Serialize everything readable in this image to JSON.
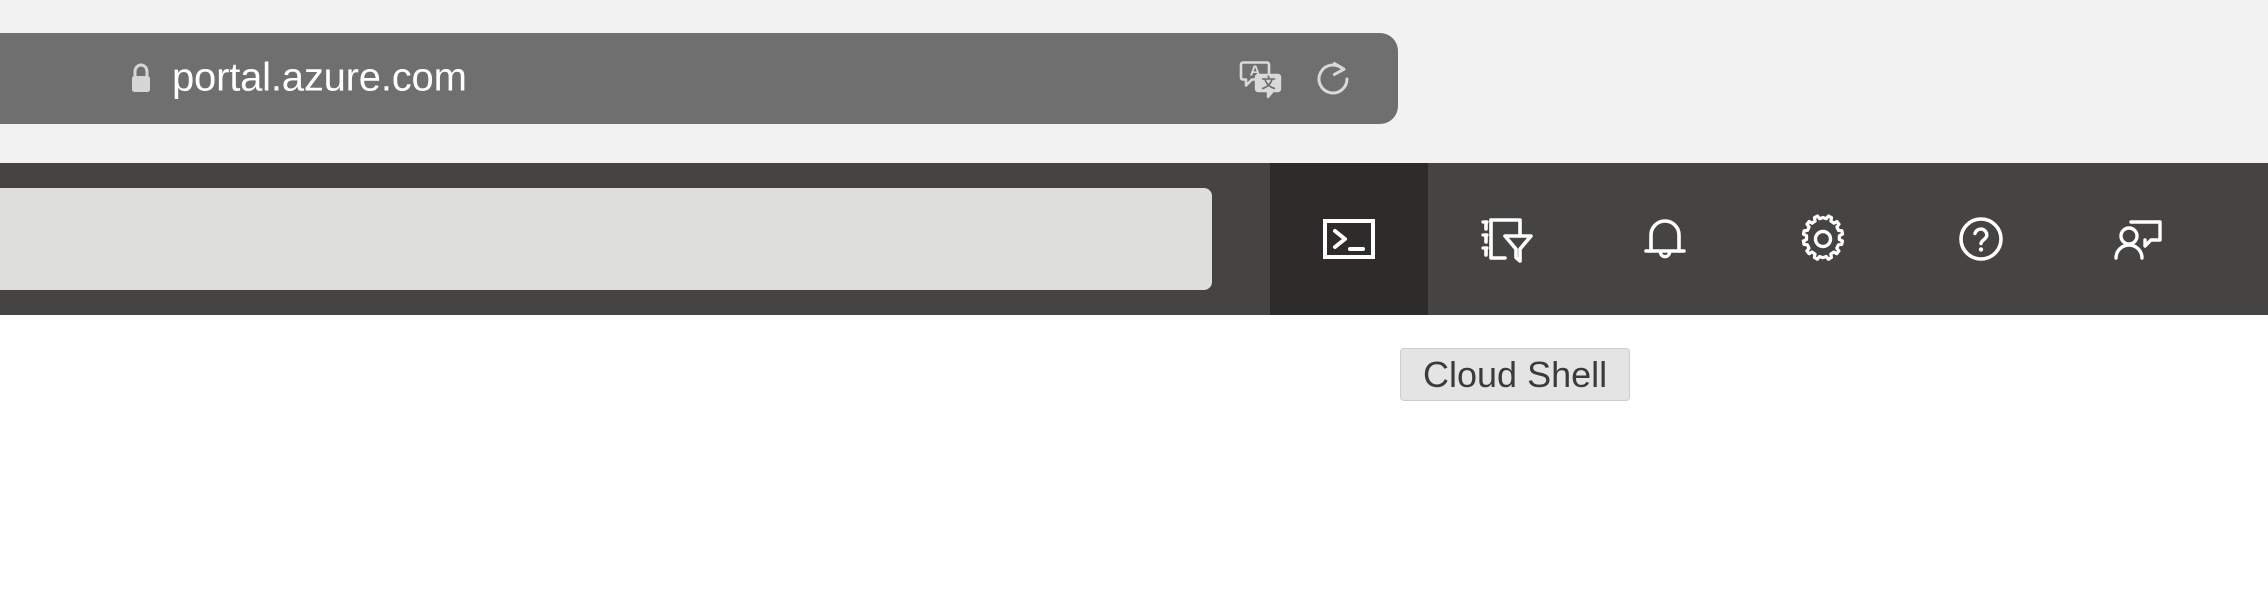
{
  "browser": {
    "address_bar": {
      "url": "portal.azure.com",
      "secure_icon": "lock-icon",
      "translate_icon": "translate-icon",
      "reload_icon": "reload-icon",
      "background_color": "#706f6f",
      "text_color": "#ffffff"
    },
    "chrome_background": "#f2f2f2"
  },
  "portal": {
    "toolbar": {
      "background_color": "#464442",
      "active_item_background": "#2e2c2b",
      "search": {
        "value": "",
        "placeholder": "",
        "background_color": "#dededd"
      },
      "actions": [
        {
          "name": "cloud-shell",
          "label": "Cloud Shell",
          "icon": "terminal-icon",
          "active": true
        },
        {
          "name": "directories-subscriptions",
          "label": "Directories + subscriptions",
          "icon": "directory-filter-icon",
          "active": false
        },
        {
          "name": "notifications",
          "label": "Notifications",
          "icon": "bell-icon",
          "active": false
        },
        {
          "name": "settings",
          "label": "Settings",
          "icon": "gear-icon",
          "active": false
        },
        {
          "name": "help",
          "label": "Help",
          "icon": "question-circle-icon",
          "active": false
        },
        {
          "name": "feedback",
          "label": "Feedback",
          "icon": "person-feedback-icon",
          "active": false
        }
      ]
    },
    "tooltip": {
      "text": "Cloud Shell",
      "background_color": "#e4e4e4",
      "border_color": "#cdcdcd",
      "text_color": "#3b3b3b"
    },
    "content_background": "#ffffff"
  }
}
